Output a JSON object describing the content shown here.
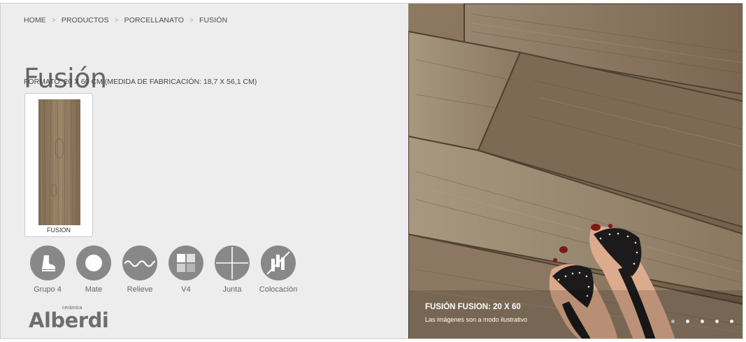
{
  "breadcrumb": [
    "HOME",
    "PRODUCTOS",
    "PORCELLANATO",
    "FUSIÓN"
  ],
  "breadcrumb_separator": ">",
  "product": {
    "title": "Fusión",
    "format": "FORMATO: 20 X 60 CM (MEDIDA DE FABRICACIÓN: 18,7 X 56,1 CM)",
    "thumbnail_caption": "FUSION"
  },
  "features": [
    {
      "label": "Grupo 4",
      "icon": "boot-icon"
    },
    {
      "label": "Mate",
      "icon": "mate-circle-icon"
    },
    {
      "label": "Relieve",
      "icon": "wave-icon"
    },
    {
      "label": "V4",
      "icon": "tone-variation-icon"
    },
    {
      "label": "Junta",
      "icon": "joint-cross-icon"
    },
    {
      "label": "Colocación",
      "icon": "placement-icon"
    }
  ],
  "logo": {
    "small": "cerámica",
    "big": "Alberdi"
  },
  "gallery": {
    "caption_title": "FUSIÓN FUSION: 20 X 60",
    "caption_subtitle": "Las imágenes son a modo ilustrativo",
    "slide_count": 5,
    "active_slide": 1
  },
  "colors": {
    "panel_bg": "#ededed",
    "icon_circle": "#888888",
    "text_dark": "#444444",
    "wood": "#8a7257"
  }
}
